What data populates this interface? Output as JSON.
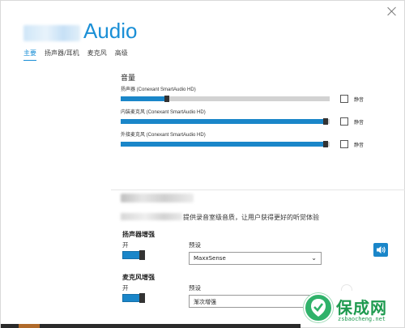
{
  "app": {
    "title": "Audio"
  },
  "tabs": [
    {
      "label": "主要",
      "active": true
    },
    {
      "label": "扬声器/耳机",
      "active": false
    },
    {
      "label": "麦克风",
      "active": false
    },
    {
      "label": "高级",
      "active": false
    }
  ],
  "volume": {
    "title": "音量",
    "devices": [
      {
        "label": "扬声器 (Conexant SmartAudio HD)",
        "level": 0.22,
        "muted": false,
        "mute_label": "静音"
      },
      {
        "label": "内装麦克风 (Conexant SmartAudio HD)",
        "level": 0.98,
        "muted": false,
        "mute_label": "静音"
      },
      {
        "label": "外接麦克风 (Conexant SmartAudio HD)",
        "level": 0.98,
        "muted": false,
        "mute_label": "静音"
      }
    ]
  },
  "enhance": {
    "description": "提供录音室级音质，让用户获得更好的听觉体验",
    "speaker": {
      "title": "扬声器增强",
      "state_label": "开",
      "preset_label": "预设",
      "preset_value": "MaxxSense"
    },
    "mic": {
      "title": "麦克风增强",
      "state_label": "开",
      "preset_label": "预设",
      "preset_value": "渐次增强"
    }
  },
  "watermark": {
    "text": "保成网",
    "url": "zsbaocheng.net"
  },
  "colors": {
    "accent": "#1a8fd6",
    "fill": "#1a86c9",
    "watermark": "#2fb26a"
  },
  "icons": {
    "close": "close-icon",
    "speaker": "speaker-icon",
    "chevron": "chevron-down-icon"
  }
}
